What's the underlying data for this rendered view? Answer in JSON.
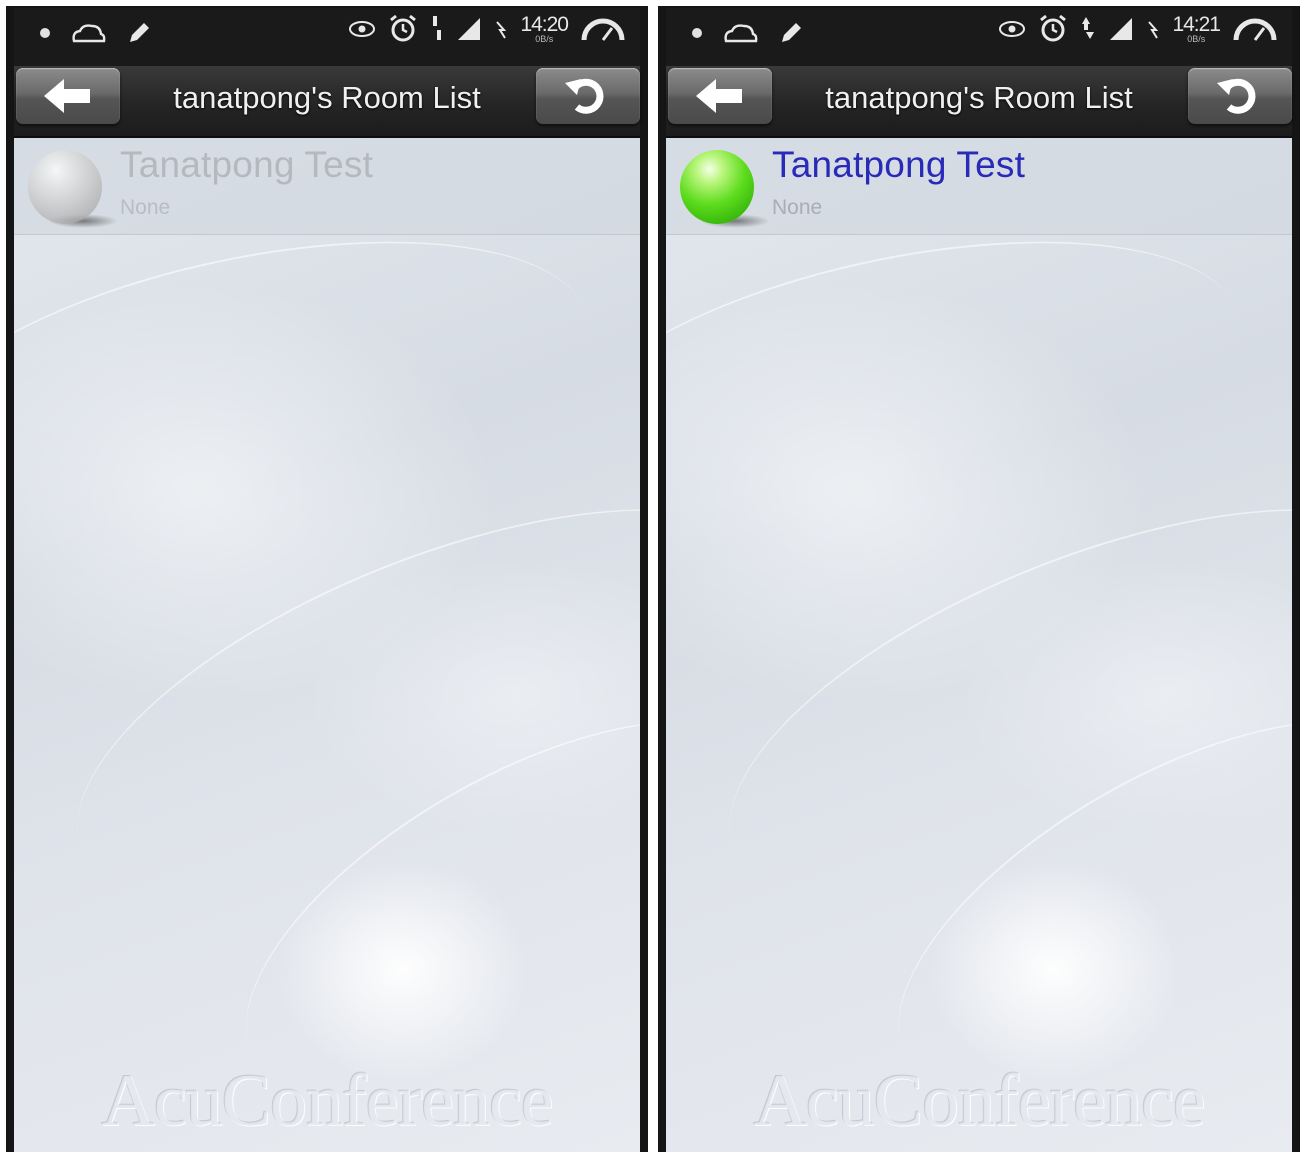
{
  "screens": [
    {
      "status": {
        "time": "14:20",
        "rate": "0B/s"
      },
      "header": {
        "title": "tanatpong's Room List"
      },
      "room": {
        "name": "Tanatpong Test",
        "subtitle": "None",
        "state": "offline",
        "name_color": "#b4b9c0",
        "sub_color": "#b8bdc4"
      },
      "watermark": "AcuConference"
    },
    {
      "status": {
        "time": "14:21",
        "rate": "0B/s"
      },
      "header": {
        "title": "tanatpong's Room List"
      },
      "room": {
        "name": "Tanatpong Test",
        "subtitle": "None",
        "state": "online",
        "name_color": "#2a2ab8",
        "sub_color": "#a9aeb6"
      },
      "watermark": "AcuConference"
    }
  ],
  "icons": [
    "notification-dot-icon",
    "cloud-icon",
    "pencil-icon",
    "eye-icon",
    "alarm-icon",
    "data-arrows-icon",
    "signal-icon",
    "nfc-icon",
    "speed-gauge-icon",
    "back-arrow-icon",
    "refresh-icon"
  ]
}
